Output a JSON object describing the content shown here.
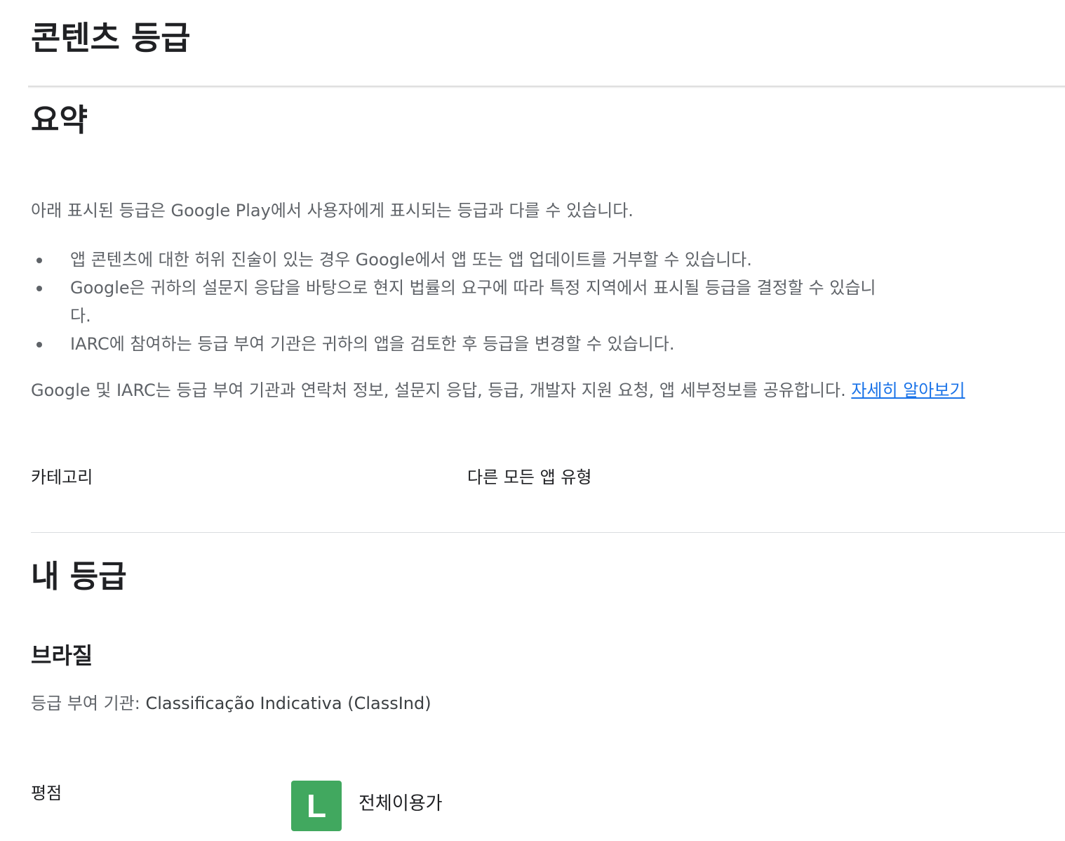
{
  "page": {
    "title": "콘텐츠 등급"
  },
  "summary": {
    "title": "요약",
    "intro": "아래 표시된 등급은 Google Play에서 사용자에게 표시되는 등급과 다를 수 있습니다.",
    "bullets": [
      "앱 콘텐츠에 대한 허위 진술이 있는 경우 Google에서 앱 또는 앱 업데이트를 거부할 수 있습니다.",
      "Google은 귀하의 설문지 응답을 바탕으로 현지 법률의 요구에 따라 특정 지역에서 표시될 등급을 결정할 수 있습니다.",
      "IARC에 참여하는 등급 부여 기관은 귀하의 앱을 검토한 후 등급을 변경할 수 있습니다."
    ],
    "share_text": "Google 및 IARC는 등급 부여 기관과 연락처 정보, 설문지 응답, 등급, 개발자 지원 요청, 앱 세부정보를 공유합니다.",
    "learn_more": "자세히 알아보기",
    "category_label": "카테고리",
    "category_value": "다른 모든 앱 유형"
  },
  "ratings": {
    "title": "내 등급",
    "region": "브라질",
    "authority_prefix": "등급 부여 기관:",
    "authority_name": "Classificação Indicativa (ClassInd)",
    "rating_label": "평점",
    "badge_text": "L",
    "badge_color": "#41a85f",
    "rating_value": "전체이용가"
  },
  "colors": {
    "link": "#1a73e8",
    "secondary_text": "#5f6368",
    "primary_text": "#202124"
  }
}
